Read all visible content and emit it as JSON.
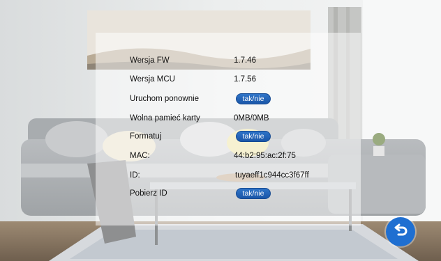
{
  "settings": {
    "rows": [
      {
        "label": "Wersja FW",
        "value": "1.7.46"
      },
      {
        "label": "Wersja MCU",
        "value": "1.7.56"
      },
      {
        "label": "Uruchom ponownie",
        "button": "tak/nie"
      },
      {
        "label": "Wolna pamieć karty",
        "value": "0MB/0MB"
      },
      {
        "label": "Formatuj",
        "button": "tak/nie"
      },
      {
        "label": "MAC:",
        "value": "44:b2:95:ac:2f:75"
      },
      {
        "label": "ID:",
        "value": "tuyaeff1c944cc3f67ff"
      },
      {
        "label": "Pobierz ID",
        "button": "tak/nie"
      }
    ]
  },
  "icons": {
    "back": "back-arrow-icon"
  },
  "colors": {
    "button": "#1b57a8",
    "back_button": "#1f6fd1"
  }
}
